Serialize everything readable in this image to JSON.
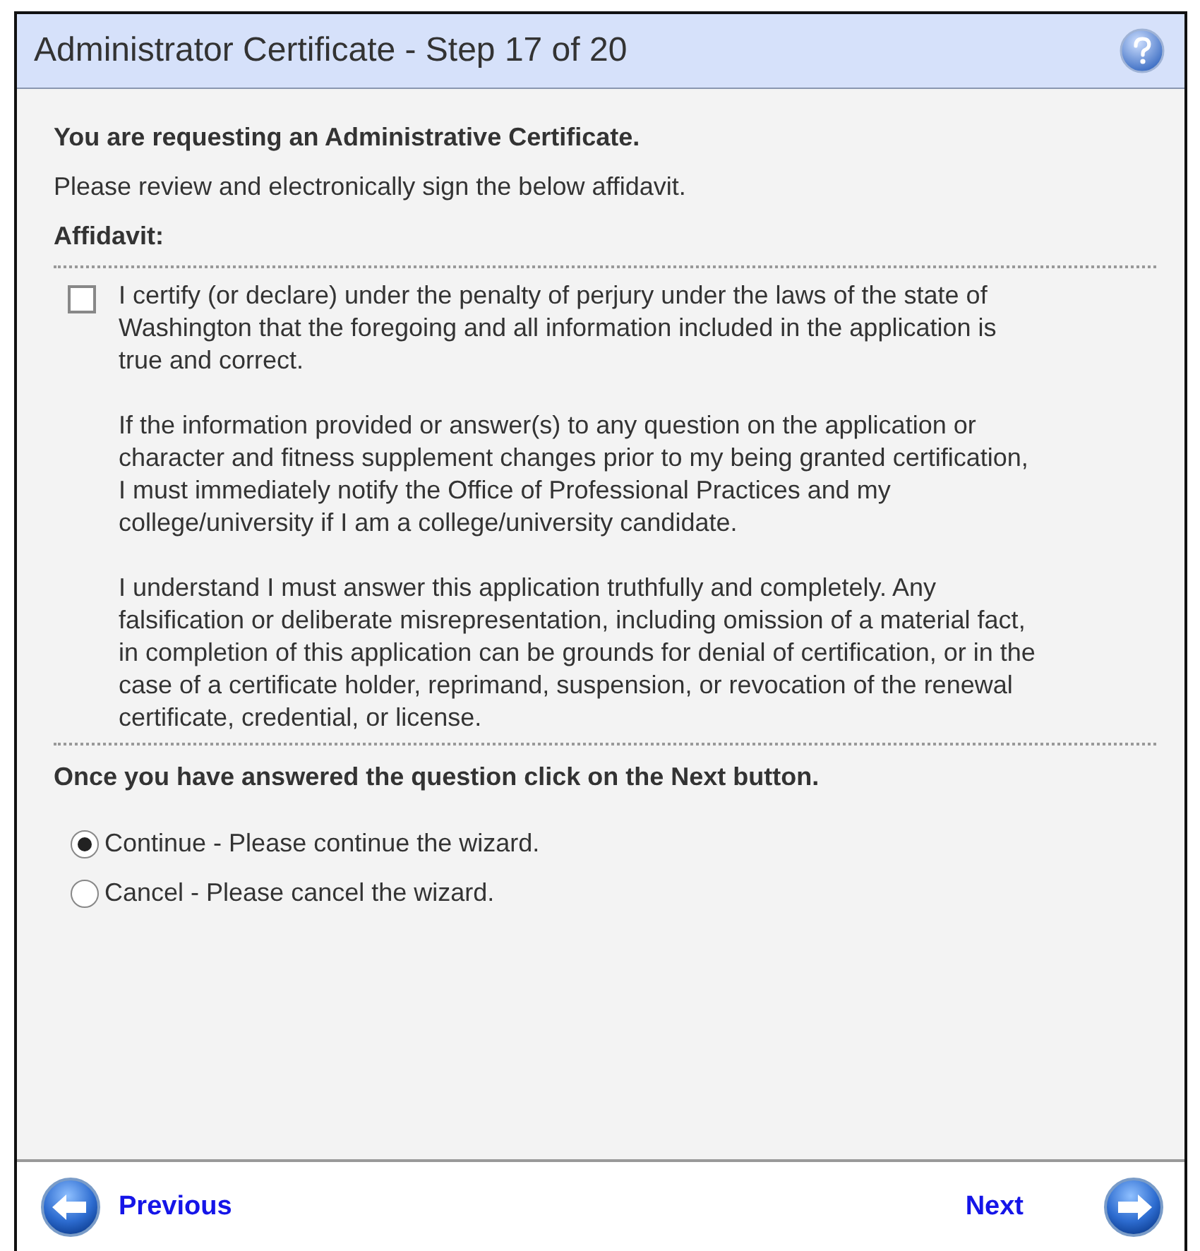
{
  "window": {
    "title": "Administrator Certificate - Step 17 of 20"
  },
  "intro": {
    "heading": "You are requesting an Administrative Certificate.",
    "instruction": "Please review and electronically sign the below affidavit."
  },
  "affidavit": {
    "label": "Affidavit:",
    "checked": false,
    "paragraphs": [
      "I certify (or declare) under the penalty of perjury under the laws of the state of Washington that the foregoing and all information included in the application is true and correct.",
      "If the information provided or answer(s) to any question on the application or character and fitness supplement changes prior to my being granted certification, I must immediately notify the Office of Professional Practices and my college/university if I am a college/university candidate.",
      "I understand I must answer this application truthfully and completely. Any falsification or deliberate misrepresentation, including omission of a material fact, in completion of this application can be grounds for denial of certification, or in the case of a certificate holder, reprimand, suspension, or revocation of the renewal certificate, credential, or license."
    ]
  },
  "question": "Once you have answered the question click on the Next button.",
  "options": [
    {
      "label": "Continue - Please continue the wizard.",
      "selected": true
    },
    {
      "label": "Cancel - Please cancel the wizard.",
      "selected": false
    }
  ],
  "footer": {
    "previous": "Previous",
    "next": "Next"
  }
}
